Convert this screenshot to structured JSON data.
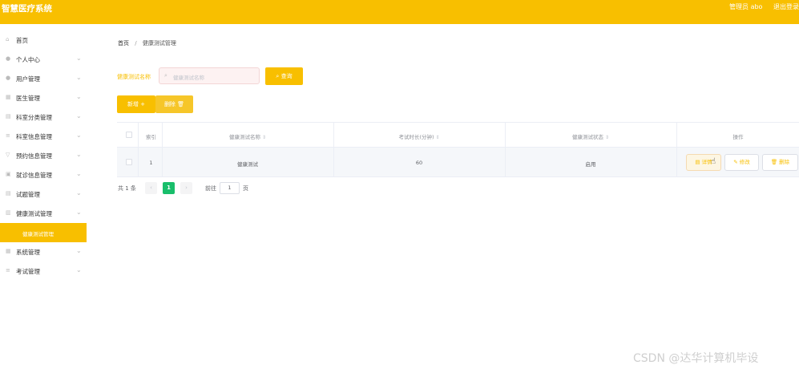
{
  "header": {
    "app_title": "智慧医疗系统",
    "admin_text": "管理员 abo",
    "logout_label": "退出登录"
  },
  "sidebar": {
    "items": [
      {
        "label": "首页",
        "icon": "home-icon",
        "has_chevron": false
      },
      {
        "label": "个人中心",
        "icon": "user-icon",
        "has_chevron": true
      },
      {
        "label": "用户管理",
        "icon": "users-icon",
        "has_chevron": true
      },
      {
        "label": "医生管理",
        "icon": "grid-icon",
        "has_chevron": true
      },
      {
        "label": "科室分类管理",
        "icon": "doc-icon",
        "has_chevron": true
      },
      {
        "label": "科室信息管理",
        "icon": "list-icon",
        "has_chevron": true
      },
      {
        "label": "预约信息管理",
        "icon": "filter-icon",
        "has_chevron": true
      },
      {
        "label": "就诊信息管理",
        "icon": "calendar-icon",
        "has_chevron": true
      },
      {
        "label": "试题管理",
        "icon": "doc-icon",
        "has_chevron": true
      },
      {
        "label": "健康测试管理",
        "icon": "chart-icon",
        "has_chevron": true
      },
      {
        "label": "健康测试管理",
        "icon": "",
        "has_chevron": false,
        "active": true
      },
      {
        "label": "系统管理",
        "icon": "grid-icon",
        "has_chevron": true
      },
      {
        "label": "考试管理",
        "icon": "list-icon",
        "has_chevron": true
      }
    ]
  },
  "breadcrumb": {
    "home": "首页",
    "separator": "/",
    "current": "健康测试管理"
  },
  "search": {
    "label": "健康测试名称",
    "placeholder": "健康测试名称",
    "query_button": "查询"
  },
  "actions": {
    "add_label": "新增",
    "delete_label": "删除"
  },
  "table": {
    "columns": {
      "index": "索引",
      "name": "健康测试名称",
      "duration": "考试时长(分钟)",
      "status": "健康测试状态",
      "operations": "操作"
    },
    "rows": [
      {
        "index": "1",
        "name": "健康测试",
        "duration": "60",
        "status": "启用"
      }
    ],
    "row_actions": {
      "detail": "详情",
      "edit": "修改",
      "remove": "删除"
    }
  },
  "pagination": {
    "total_text": "共 1 条",
    "prev": "‹",
    "current_page": "1",
    "next": "›",
    "goto_label": "前往",
    "goto_value": "1",
    "page_label": "页"
  },
  "watermark": "CSDN @达华计算机毕设",
  "colors": {
    "brand": "#f8bf00",
    "pager_active": "#19be6b"
  }
}
